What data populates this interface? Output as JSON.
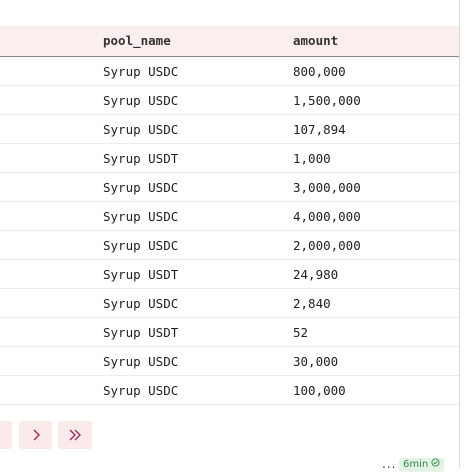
{
  "table": {
    "columns": [
      "pool_name",
      "amount"
    ],
    "rows": [
      [
        "Syrup USDC",
        "800,000"
      ],
      [
        "Syrup USDC",
        "1,500,000"
      ],
      [
        "Syrup USDC",
        "107,894"
      ],
      [
        "Syrup USDT",
        "1,000"
      ],
      [
        "Syrup USDC",
        "3,000,000"
      ],
      [
        "Syrup USDC",
        "4,000,000"
      ],
      [
        "Syrup USDC",
        "2,000,000"
      ],
      [
        "Syrup USDT",
        "24,980"
      ],
      [
        "Syrup USDC",
        "2,840"
      ],
      [
        "Syrup USDT",
        "52"
      ],
      [
        "Syrup USDC",
        "30,000"
      ],
      [
        "Syrup USDC",
        "100,000"
      ]
    ]
  },
  "pagination": {
    "icons": [
      "prev-page-icon",
      "next-page-icon",
      "last-page-icon"
    ]
  },
  "footer": {
    "more_label": "...",
    "status_badge": "6min",
    "status_icon": "check-circle-icon"
  },
  "colors": {
    "header_bg": "#fbeeee",
    "button_bg": "#fbeaea",
    "accent": "#9b2d5a",
    "badge_bg": "#e3f4e6",
    "badge_text": "#2f8a45"
  }
}
